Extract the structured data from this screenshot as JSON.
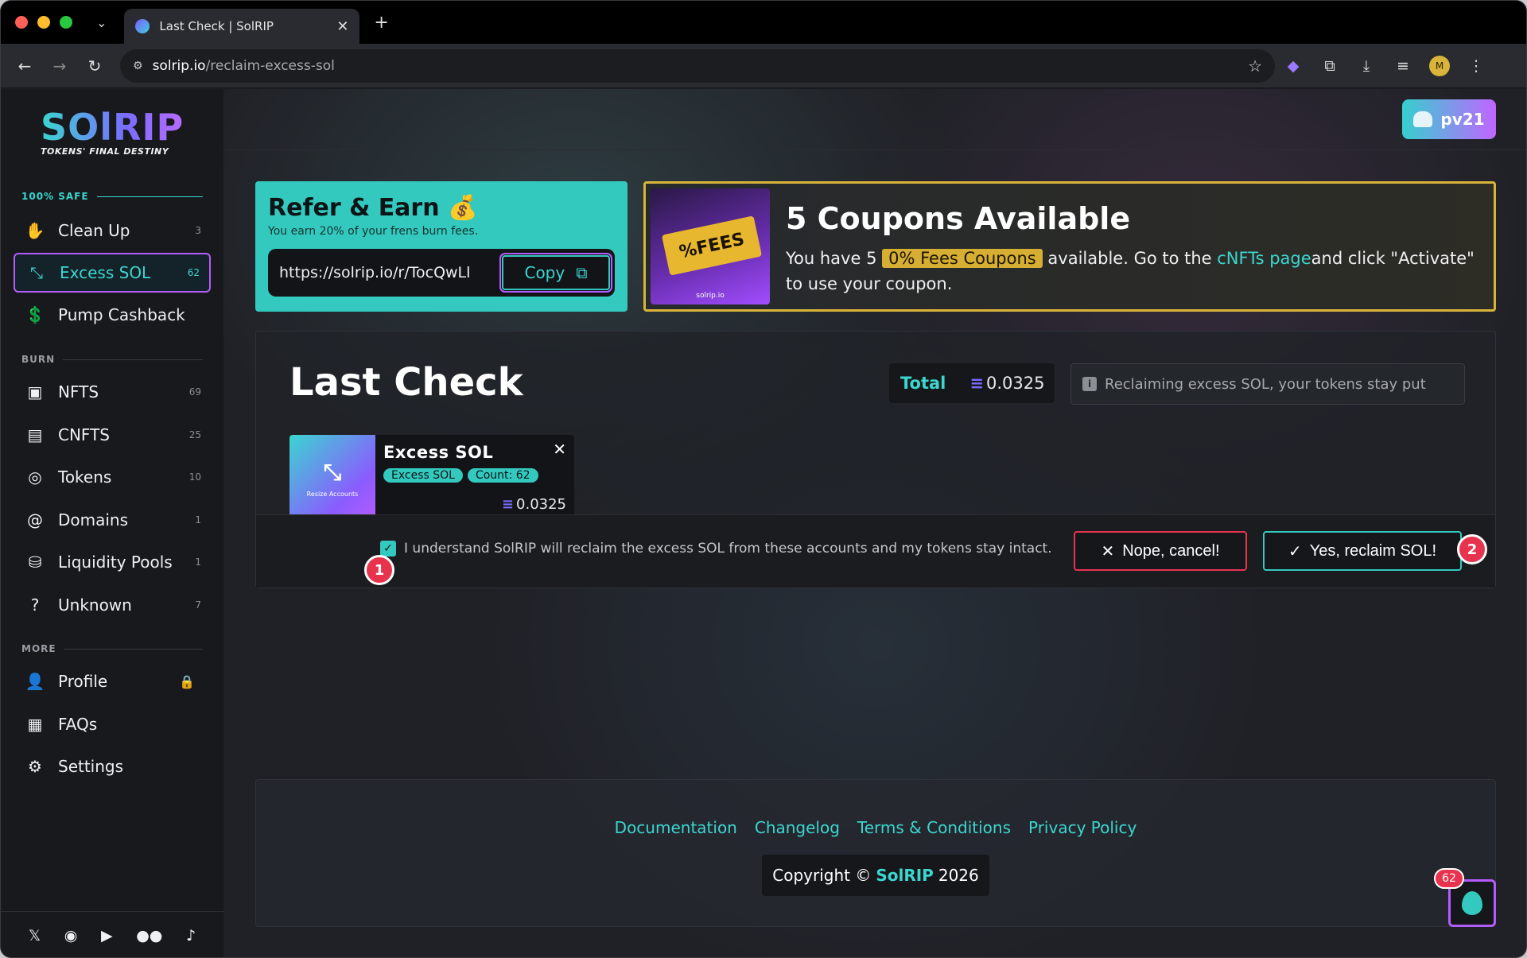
{
  "browser": {
    "tab_title": "Last Check | SolRIP",
    "url_host": "solrip.io",
    "url_path": "/reclaim-excess-sol"
  },
  "brand": {
    "logo": "SOlRIP",
    "tagline": "TOKENS' FINAL DESTINY",
    "accent": "#33c9bf",
    "purple": "#b45cff",
    "danger": "#e8334f",
    "gold": "#d8b43a"
  },
  "user": {
    "name": "pv21"
  },
  "sidebar": {
    "section_safe": "100% SAFE",
    "section_burn": "BURN",
    "section_more": "MORE",
    "safe_items": [
      {
        "label": "Clean Up",
        "count": "3",
        "icon": "hand-sparkle-icon"
      },
      {
        "label": "Excess SOL",
        "count": "62",
        "icon": "compress-icon"
      },
      {
        "label": "Pump Cashback",
        "count": "",
        "icon": "hand-coin-icon"
      }
    ],
    "burn_items": [
      {
        "label": "NFTS",
        "count": "69",
        "icon": "image-icon"
      },
      {
        "label": "CNFTS",
        "count": "25",
        "icon": "cnft-icon"
      },
      {
        "label": "Tokens",
        "count": "10",
        "icon": "coins-icon"
      },
      {
        "label": "Domains",
        "count": "1",
        "icon": "at-icon"
      },
      {
        "label": "Liquidity Pools",
        "count": "1",
        "icon": "pool-icon"
      },
      {
        "label": "Unknown",
        "count": "7",
        "icon": "question-icon"
      }
    ],
    "more_items": [
      {
        "label": "Profile",
        "icon": "user-icon"
      },
      {
        "label": "FAQs",
        "icon": "document-icon"
      },
      {
        "label": "Settings",
        "icon": "gear-icon"
      }
    ]
  },
  "refer": {
    "title": "Refer & Earn 💰",
    "subtitle": "You earn 20% of your frens burn fees.",
    "link": "https://solrip.io/r/TocQwLl",
    "copy_label": "Copy"
  },
  "coupons": {
    "title": "5 Coupons Available",
    "desc_1": "You have 5 ",
    "highlight": "0% Fees Coupons",
    "desc_2": " available. Go to the ",
    "link": "cNFTs page",
    "desc_3": "and click \"Activate\" to use your coupon.",
    "img_text": "%FEES",
    "img_brand": "solrip.io"
  },
  "last_check": {
    "title": "Last Check",
    "total_label": "Total",
    "total_value": "0.0325",
    "note": "Reclaiming excess SOL, your tokens stay put",
    "card": {
      "thumb_label": "Resize Accounts",
      "name": "Excess SOL",
      "tag_1": "Excess SOL",
      "tag_2": "Count: 62",
      "value": "0.0325"
    },
    "consent": "I understand SolRIP will reclaim the excess SOL from these accounts and my tokens stay intact.",
    "cancel_label": "Nope, cancel!",
    "confirm_label": "Yes, reclaim SOL!",
    "marker_1": "1",
    "marker_2": "2"
  },
  "footer": {
    "links": [
      "Documentation",
      "Changelog",
      "Terms & Conditions",
      "Privacy Policy"
    ],
    "copyright_prefix": "Copyright ©",
    "copyright_brand": "SolRIP",
    "copyright_year": "2026"
  },
  "float_badge": "62"
}
